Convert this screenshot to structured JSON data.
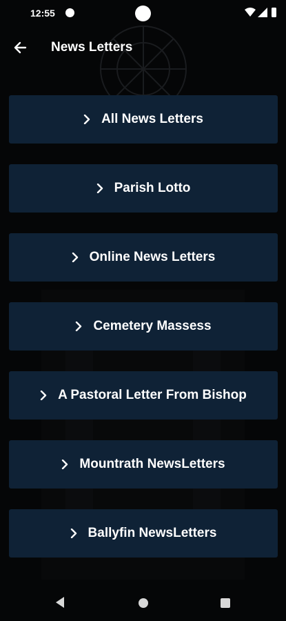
{
  "status_bar": {
    "time": "12:55",
    "icons": [
      "notification-app-icon",
      "wifi-icon",
      "signal-icon",
      "battery-icon"
    ]
  },
  "app_bar": {
    "title": "News Letters",
    "back_icon": "arrow-left-icon"
  },
  "menu": {
    "items": [
      {
        "label": "All News Letters"
      },
      {
        "label": "Parish Lotto"
      },
      {
        "label": "Online News Letters"
      },
      {
        "label": "Cemetery Massess"
      },
      {
        "label": "A Pastoral Letter From Bishop"
      },
      {
        "label": "Mountrath NewsLetters"
      },
      {
        "label": "Ballyfin NewsLetters"
      }
    ],
    "item_icon": "chevron-right-icon"
  },
  "nav_bar": {
    "icons": [
      "nav-back-icon",
      "nav-home-icon",
      "nav-recents-icon"
    ]
  },
  "colors": {
    "background": "#050607",
    "button": "#0f2236",
    "text": "#ffffff"
  }
}
